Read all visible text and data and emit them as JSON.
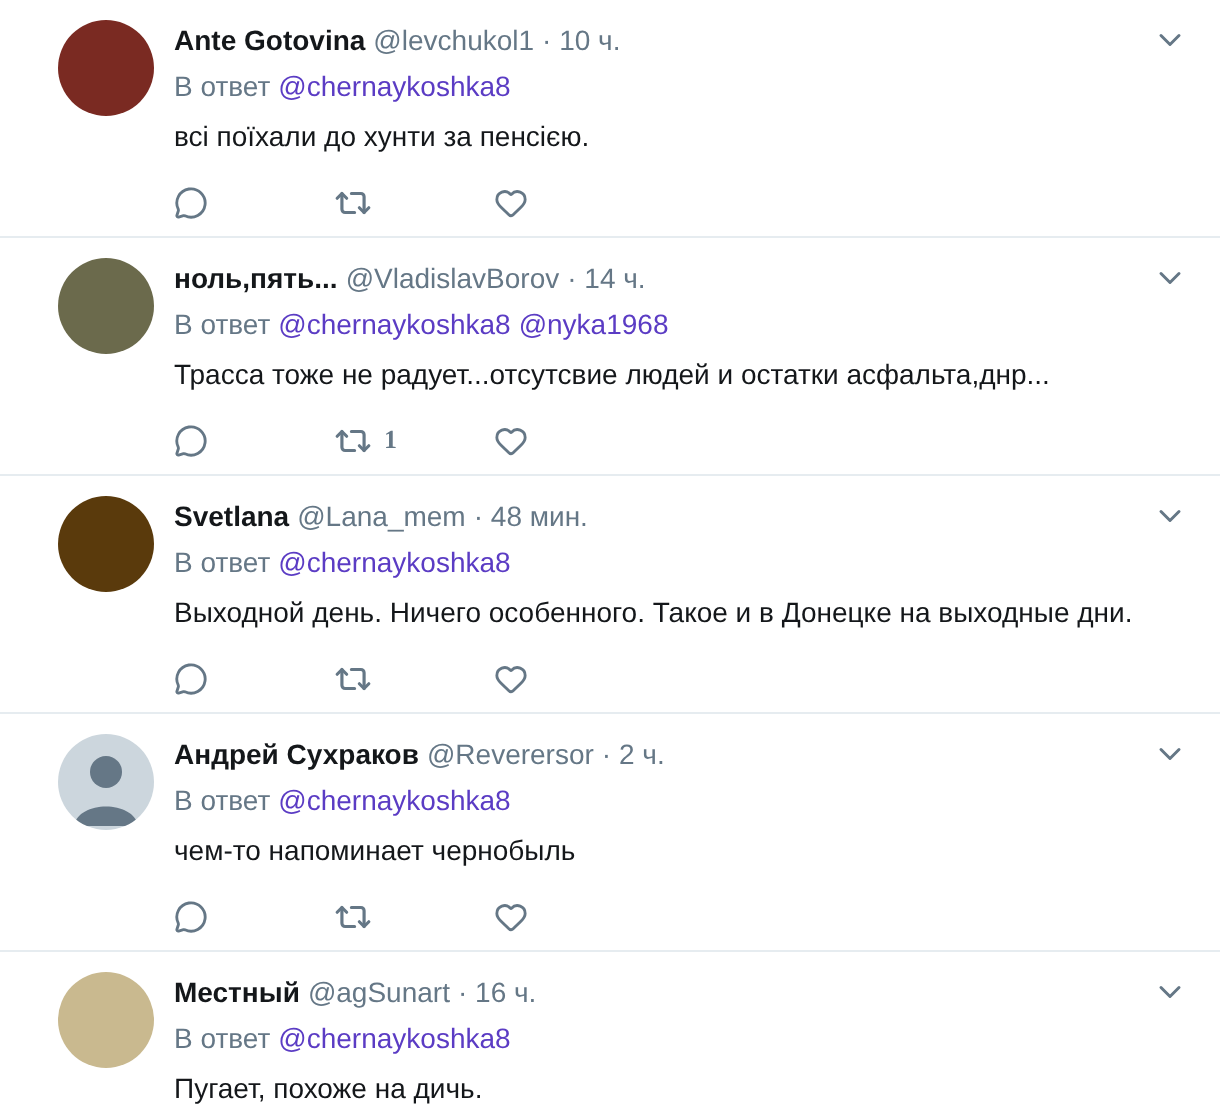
{
  "tweets": [
    {
      "avatar": {
        "kind": "photo",
        "color": "#7a2a22"
      },
      "name": "Ante Gotovina",
      "handle": "@levchukol1",
      "time": "· 10 ч.",
      "reply_label": "В ответ",
      "mentions": [
        "@chernaykoshka8"
      ],
      "text": "всі поїхали до хунти за пенсією."
    },
    {
      "avatar": {
        "kind": "photo",
        "color": "#6b6a4c"
      },
      "name": "ноль,пять...",
      "handle": "@VladislavBorov",
      "time": "· 14 ч.",
      "reply_label": "В ответ",
      "mentions": [
        "@chernaykoshka8",
        "@nyka1968"
      ],
      "text": "Трасса тоже не радует...отсутсвие людей и остатки асфальта,днр...",
      "retweets": "1"
    },
    {
      "avatar": {
        "kind": "photo",
        "color": "#5a3a0c"
      },
      "name": "Svetlana",
      "handle": "@Lana_mem",
      "time": "· 48 мин.",
      "reply_label": "В ответ",
      "mentions": [
        "@chernaykoshka8"
      ],
      "text": "Выходной день. Ничего особенного. Такое и в Донецке на выходные дни."
    },
    {
      "avatar": {
        "kind": "default",
        "color": "#ccd6dd"
      },
      "name": "Андрей Сухраков",
      "handle": "@Reverersor",
      "time": "· 2 ч.",
      "reply_label": "В ответ",
      "mentions": [
        "@chernaykoshka8"
      ],
      "text": "чем-то напоминает чернобыль"
    },
    {
      "avatar": {
        "kind": "photo",
        "color": "#c9b98f"
      },
      "name": "Местный",
      "handle": "@agSunart",
      "time": "· 16 ч.",
      "reply_label": "В ответ",
      "mentions": [
        "@chernaykoshka8"
      ],
      "text": "Пугает, похоже на дичь."
    }
  ]
}
